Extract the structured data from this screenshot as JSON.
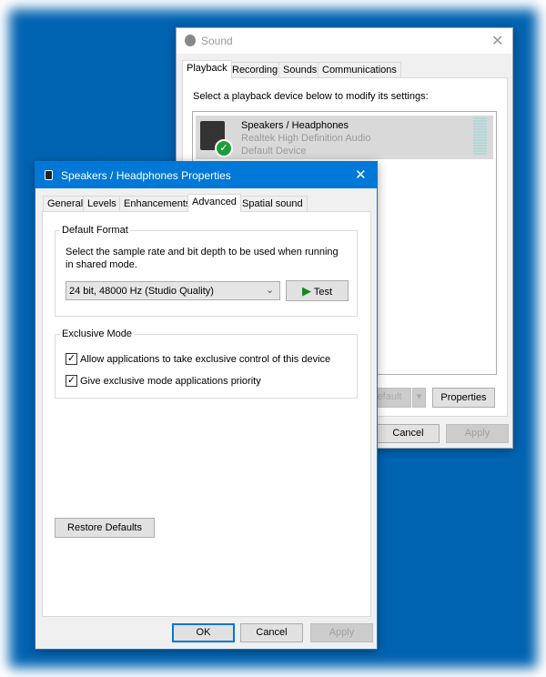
{
  "sound": {
    "title": "Sound",
    "tabs": [
      "Playback",
      "Recording",
      "Sounds",
      "Communications"
    ],
    "active_tab": "Playback",
    "instruction": "Select a playback device below to modify its settings:",
    "device": {
      "name": "Speakers / Headphones",
      "driver": "Realtek High Definition Audio",
      "status": "Default Device"
    },
    "buttons": {
      "set_default": "efault",
      "properties": "Properties",
      "cancel": "Cancel",
      "apply": "Apply"
    }
  },
  "props": {
    "title": "Speakers / Headphones Properties",
    "tabs": [
      "General",
      "Levels",
      "Enhancements",
      "Advanced",
      "Spatial sound"
    ],
    "active_tab": "Advanced",
    "default_format": {
      "label": "Default Format",
      "description": "Select the sample rate and bit depth to be used when running in shared mode.",
      "selected": "24 bit, 48000 Hz (Studio Quality)",
      "test": "Test"
    },
    "exclusive": {
      "label": "Exclusive Mode",
      "options": [
        {
          "label": "Allow applications to take exclusive control of this device",
          "checked": true
        },
        {
          "label": "Give exclusive mode applications priority",
          "checked": true
        }
      ]
    },
    "buttons": {
      "restore": "Restore Defaults",
      "ok": "OK",
      "cancel": "Cancel",
      "apply": "Apply"
    }
  },
  "colors": {
    "desktop": "#0063b1",
    "titlebar_active": "#0078d7",
    "check_green": "#1e9e3a"
  }
}
